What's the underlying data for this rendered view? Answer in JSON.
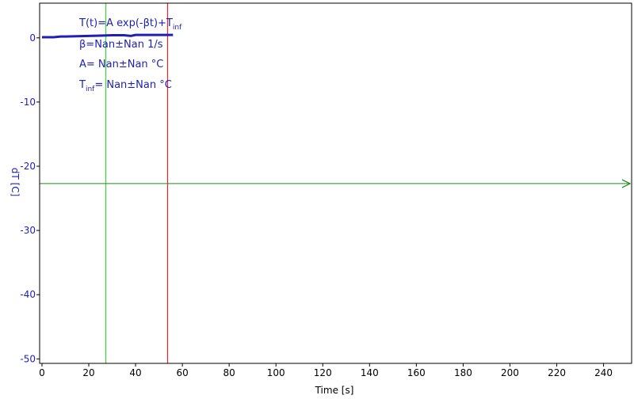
{
  "chart_data": {
    "type": "line",
    "xlabel": "Time [s]",
    "ylabel": "dT [C]",
    "xlim": [
      -1,
      252
    ],
    "ylim": [
      -50.7,
      5.4
    ],
    "x_ticks": [
      0,
      20,
      40,
      60,
      80,
      100,
      120,
      140,
      160,
      180,
      200,
      220,
      240
    ],
    "y_ticks": [
      0,
      -10,
      -20,
      -30,
      -40,
      -50
    ],
    "grid": false,
    "series": [
      {
        "color": "#1f1fb4",
        "x": [
          0,
          5,
          8,
          10,
          15,
          20,
          25,
          30,
          35,
          38,
          40,
          45,
          50,
          56
        ],
        "y": [
          0.1,
          0.1,
          0.2,
          0.2,
          0.25,
          0.3,
          0.35,
          0.4,
          0.4,
          0.3,
          0.45,
          0.45,
          0.45,
          0.45
        ]
      }
    ],
    "vlines": [
      {
        "x": 27.3,
        "color": "#3ad63a"
      },
      {
        "x": 53.7,
        "color": "#e02828"
      }
    ],
    "hline": {
      "y": -22.7,
      "color": "#1e8a1e",
      "arrow": "right"
    },
    "annotation": {
      "line1_main": "T(t)=A exp(-βt)+T",
      "line1_sub": "inf",
      "line2": "β=Nan±Nan 1/s",
      "line3": "A= Nan±Nan °C",
      "line4_main": "T",
      "line4_sub": "inf",
      "line4_rest": "= Nan±Nan °C"
    }
  }
}
